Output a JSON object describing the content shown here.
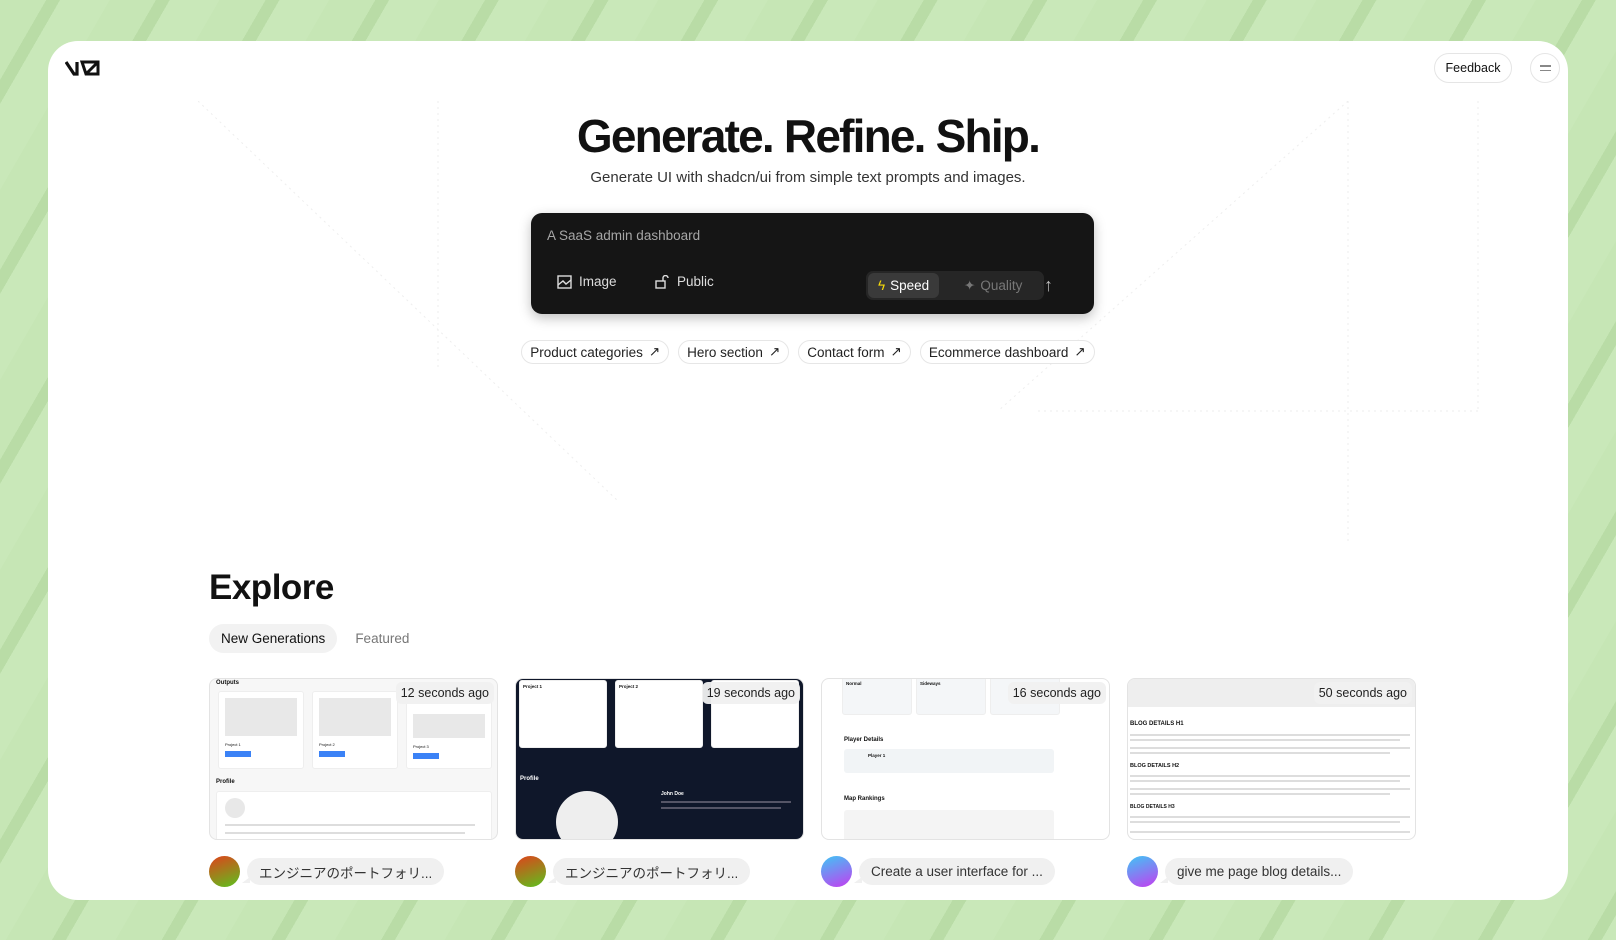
{
  "header": {
    "logo": "v0",
    "feedback_label": "Feedback",
    "menu_icon": "menu-icon"
  },
  "hero": {
    "title": "Generate. Refine. Ship.",
    "subtitle": "Generate UI with shadcn/ui from simple text prompts and images."
  },
  "prompt": {
    "placeholder": "A SaaS admin dashboard",
    "image_label": "Image",
    "public_label": "Public",
    "speed_label": "Speed",
    "quality_label": "Quality",
    "selected_mode": "Speed"
  },
  "suggestions": [
    {
      "label": "Product categories"
    },
    {
      "label": "Hero section"
    },
    {
      "label": "Contact form"
    },
    {
      "label": "Ecommerce dashboard"
    }
  ],
  "explore": {
    "title": "Explore",
    "tabs": [
      {
        "label": "New Generations",
        "active": true
      },
      {
        "label": "Featured",
        "active": false
      }
    ],
    "cards": [
      {
        "time": "12 seconds ago",
        "prompt": "エンジニアのポートフォリ...",
        "avatar_colors": [
          "#e0421b",
          "#5cc21e"
        ],
        "thumb": {
          "h1": "Outputs",
          "h2": "Profile",
          "items": [
            "Project 1",
            "Project 2",
            "Project 3"
          ]
        }
      },
      {
        "time": "19 seconds ago",
        "prompt": "エンジニアのポートフォリ...",
        "avatar_colors": [
          "#e0421b",
          "#5cc21e"
        ],
        "thumb": {
          "h1": "Profile",
          "name": "John Doe",
          "items": [
            "Project 1",
            "Project 2"
          ]
        }
      },
      {
        "time": "16 seconds ago",
        "prompt": "Create a user interface for ...",
        "avatar_colors": [
          "#3fc6f5",
          "#c43df0"
        ],
        "thumb": {
          "cols": [
            "Normal",
            "Sideways"
          ],
          "h1": "Player Details",
          "player": "Player 1",
          "h2": "Map Rankings"
        }
      },
      {
        "time": "50 seconds ago",
        "prompt": "give me page blog details...",
        "avatar_colors": [
          "#3fc6f5",
          "#c43df0"
        ],
        "thumb": {
          "h1": "BLOG DETAILS H1",
          "h2": "BLOG DETAILS H2",
          "h3": "BLOG DETAILS H3"
        }
      }
    ]
  },
  "colors": {
    "background": "#c3e3b2",
    "prompt_bg": "#151515",
    "speed_icon": "#f5d90a"
  }
}
